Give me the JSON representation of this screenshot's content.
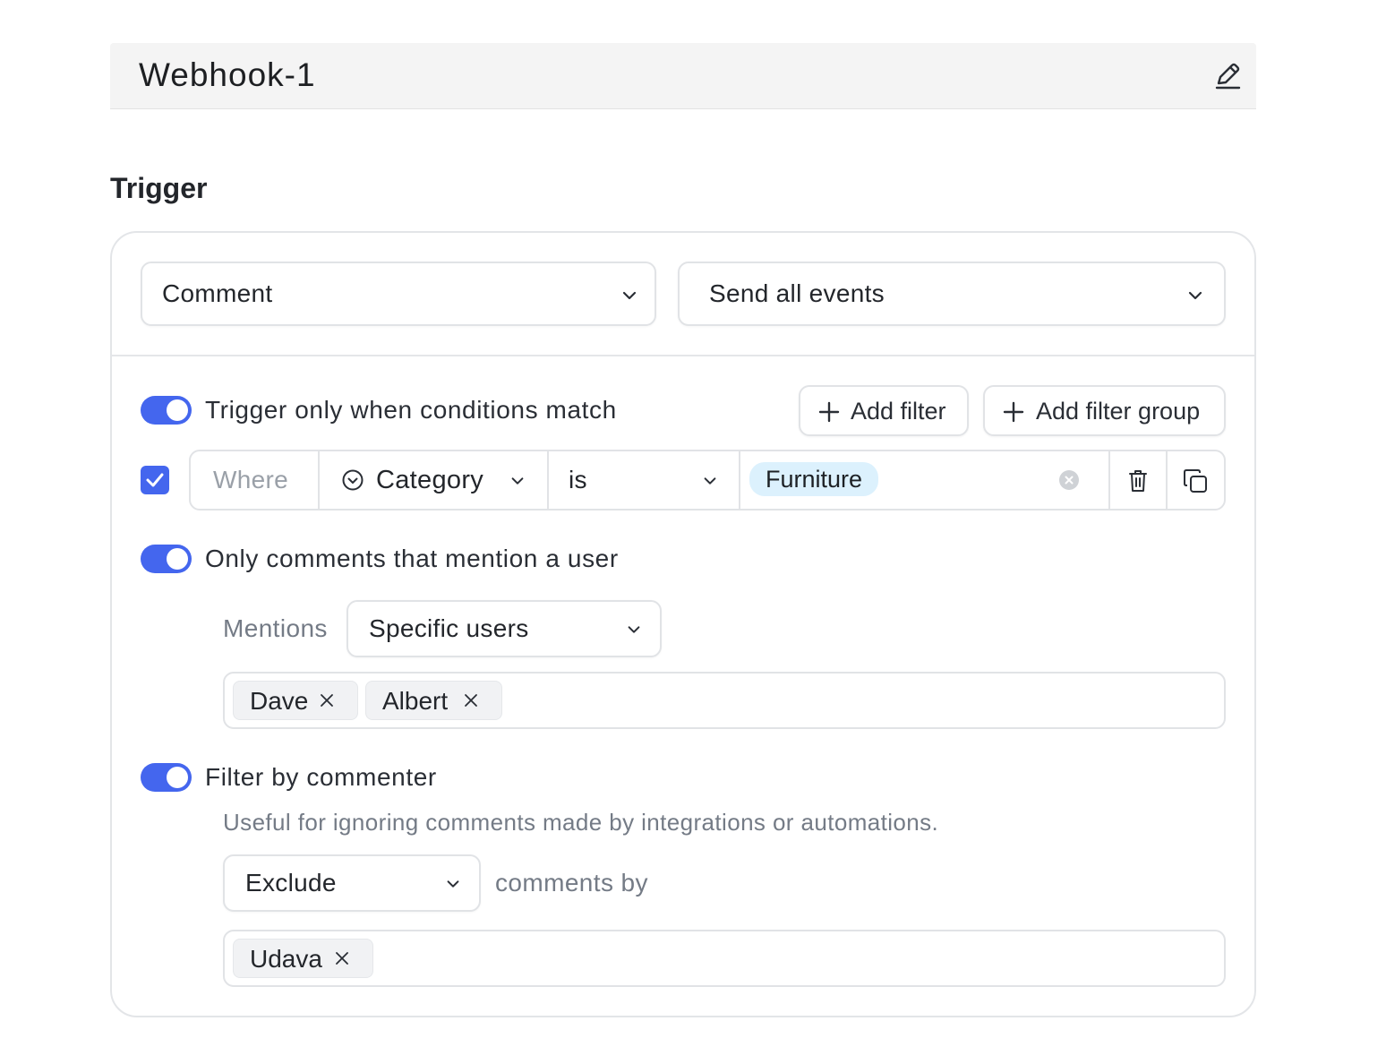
{
  "title": "Webhook-1",
  "section_heading": "Trigger",
  "trigger": {
    "event_select": "Comment",
    "events_select": "Send all events",
    "conditions_toggle_label": "Trigger only when conditions match",
    "conditions_toggle_on": true,
    "add_filter_label": "Add filter",
    "add_filter_group_label": "Add filter group",
    "filter": {
      "checked": true,
      "where_placeholder": "Where",
      "field": "Category",
      "operator": "is",
      "value": "Furniture"
    },
    "mention_toggle_label": "Only comments that mention a user",
    "mention_toggle_on": true,
    "mentions_label": "Mentions",
    "mentions_select": "Specific users",
    "mentioned_users": [
      "Dave",
      "Albert"
    ],
    "commenter_toggle_label": "Filter by commenter",
    "commenter_toggle_on": true,
    "commenter_description": "Useful for ignoring comments made by integrations or automations.",
    "commenter_mode_select": "Exclude",
    "comments_by_label": "comments by",
    "commenters": [
      "Udava"
    ]
  },
  "colors": {
    "accent": "#4466ee",
    "pill_bg": "#dcf1fd",
    "title_bar_bg": "#f4f4f4"
  }
}
